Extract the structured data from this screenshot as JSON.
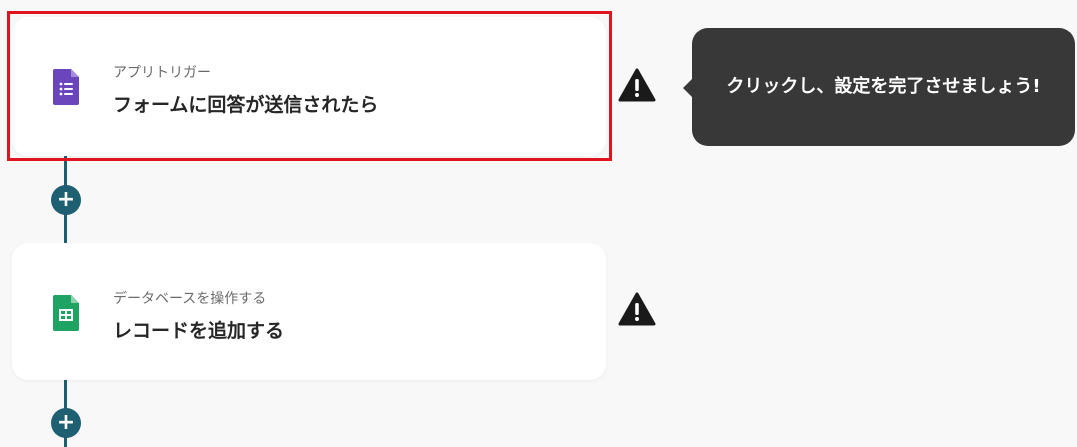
{
  "steps": [
    {
      "subtitle": "アプリトリガー",
      "title": "フォームに回答が送信されたら",
      "app_icon": "google-forms-icon",
      "icon_color": "#6b45bc",
      "status_icon": "warning-icon"
    },
    {
      "subtitle": "データベースを操作する",
      "title": "レコードを追加する",
      "app_icon": "google-sheets-icon",
      "icon_color": "#1ea362",
      "status_icon": "warning-icon"
    }
  ],
  "add_step_label": "+",
  "tooltip": {
    "text": "クリックし、設定を完了させましょう!"
  },
  "colors": {
    "connector": "#1e5f72",
    "highlight": "#e0141e",
    "tooltip_bg": "#383838",
    "warning": "#1a1a1a"
  }
}
